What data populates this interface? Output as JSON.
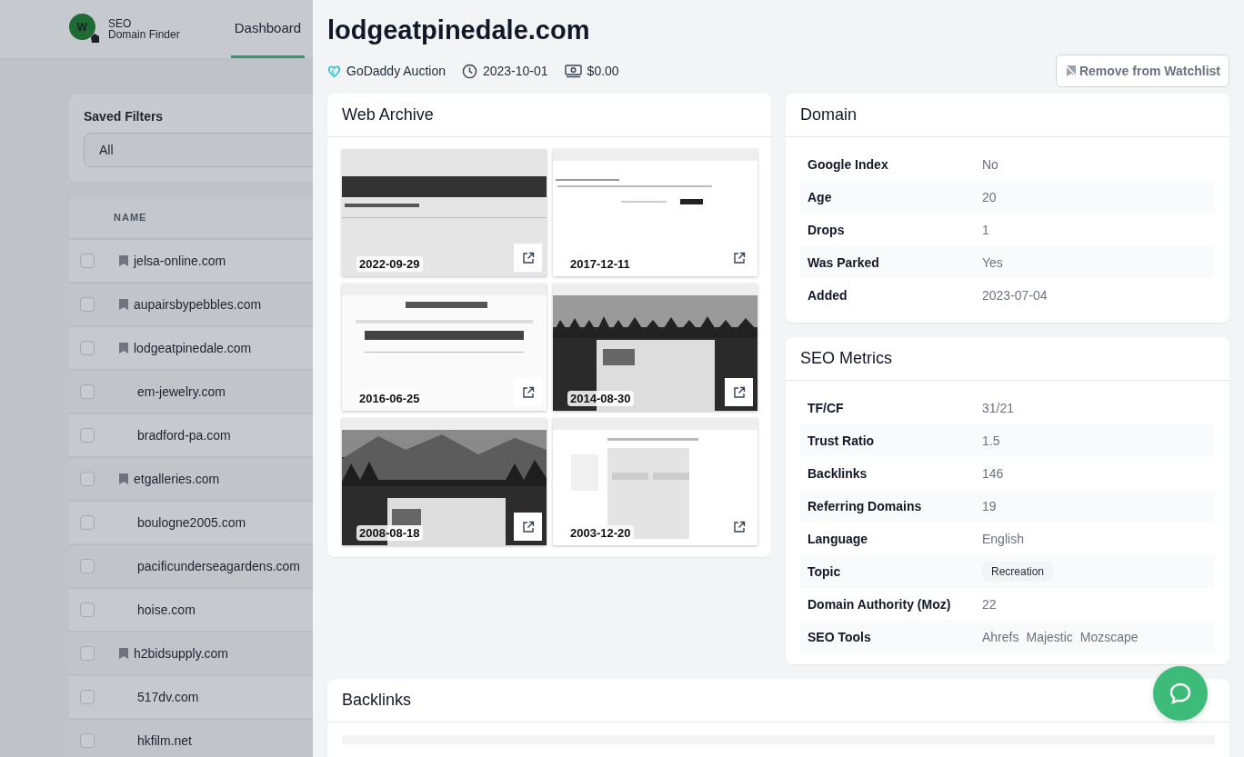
{
  "app": {
    "logo_letter": "W",
    "brand_line1": "SEO",
    "brand_line2": "Domain Finder"
  },
  "nav": [
    {
      "label": "Dashboard",
      "selected": true
    }
  ],
  "saved_filters": {
    "label": "Saved Filters",
    "value": "All"
  },
  "list": {
    "column": "NAME",
    "rows": [
      {
        "name": "jelsa-online.com",
        "bookmarked": true,
        "checked": false
      },
      {
        "name": "aupairsbypebbles.com",
        "bookmarked": true,
        "checked": false
      },
      {
        "name": "lodgeatpinedale.com",
        "bookmarked": true,
        "checked": false
      },
      {
        "name": "em-jewelry.com",
        "bookmarked": false,
        "checked": false
      },
      {
        "name": "bradford-pa.com",
        "bookmarked": false,
        "checked": false
      },
      {
        "name": "etgalleries.com",
        "bookmarked": true,
        "checked": false
      },
      {
        "name": "boulogne2005.com",
        "bookmarked": false,
        "checked": false
      },
      {
        "name": "pacificunderseagardens.com",
        "bookmarked": false,
        "checked": false
      },
      {
        "name": "hoise.com",
        "bookmarked": false,
        "checked": false
      },
      {
        "name": "h2bidsupply.com",
        "bookmarked": true,
        "checked": false
      },
      {
        "name": "517dv.com",
        "bookmarked": false,
        "checked": false
      },
      {
        "name": "hkfilm.net",
        "bookmarked": false,
        "checked": false
      }
    ]
  },
  "detail": {
    "title": "lodgeatpinedale.com",
    "source": "GoDaddy Auction",
    "date": "2023-10-01",
    "price": "$0.00",
    "watchlist_button": "Remove from Watchlist"
  },
  "web_archive": {
    "title": "Web Archive",
    "snapshots": [
      {
        "date": "2022-09-29",
        "kind": "picture"
      },
      {
        "date": "2017-12-11",
        "kind": "picture"
      },
      {
        "date": "2016-06-25",
        "kind": "picture"
      },
      {
        "date": "2014-08-30",
        "kind": "picture"
      },
      {
        "date": "2008-08-18",
        "kind": "picture"
      },
      {
        "date": "2003-12-20",
        "kind": "picture"
      }
    ]
  },
  "domain": {
    "title": "Domain",
    "rows": [
      {
        "label": "Google Index",
        "kind": "text",
        "value": "No"
      },
      {
        "label": "Age",
        "kind": "text",
        "value": "20"
      },
      {
        "label": "Drops",
        "kind": "text",
        "value": "1"
      },
      {
        "label": "Was Parked",
        "kind": "text",
        "value": "Yes"
      },
      {
        "label": "Added",
        "kind": "text",
        "value": "2023-07-04"
      }
    ]
  },
  "seo_metrics": {
    "title": "SEO Metrics",
    "rows": [
      {
        "label": "TF/CF",
        "kind": "text",
        "value": "31/21"
      },
      {
        "label": "Trust Ratio",
        "kind": "text",
        "value": "1.5"
      },
      {
        "label": "Backlinks",
        "kind": "text",
        "value": "146"
      },
      {
        "label": "Referring Domains",
        "kind": "text",
        "value": "19"
      },
      {
        "label": "Language",
        "kind": "text",
        "value": "English"
      },
      {
        "label": "Topic",
        "kind": "tag",
        "value": "Recreation"
      },
      {
        "label": "Domain Authority (Moz)",
        "kind": "text",
        "value": "22"
      },
      {
        "label": "SEO Tools",
        "kind": "links",
        "links": [
          "Ahrefs",
          "Majestic",
          "Mozscape"
        ]
      }
    ]
  },
  "backlinks": {
    "title": "Backlinks"
  }
}
